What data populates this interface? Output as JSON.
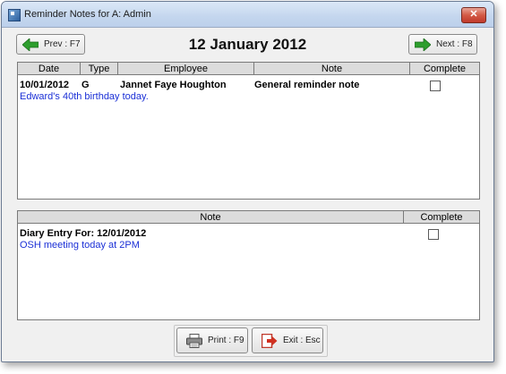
{
  "window": {
    "title": "Reminder Notes for A: Admin"
  },
  "nav": {
    "prev_label": "Prev : F7",
    "next_label": "Next : F8",
    "date_title": "12 January 2012"
  },
  "reminders": {
    "columns": [
      "Date",
      "Type",
      "Employee",
      "Note",
      "Complete"
    ],
    "rows": [
      {
        "date": "10/01/2012",
        "type": "G",
        "employee": "Jannet Faye Houghton",
        "note": "General reminder note",
        "complete": false,
        "detail": "Edward's 40th birthday today."
      }
    ]
  },
  "diary": {
    "columns": [
      "Note",
      "Complete"
    ],
    "rows": [
      {
        "heading": "Diary Entry For: 12/01/2012",
        "complete": false,
        "detail": "OSH meeting today at 2PM"
      }
    ]
  },
  "footer": {
    "print_label": "Print : F9",
    "exit_label": "Exit : Esc"
  },
  "icons": {
    "prev": "left-arrow-icon",
    "next": "right-arrow-icon",
    "print": "printer-icon",
    "exit": "exit-icon",
    "close": "close-icon",
    "app": "app-icon"
  },
  "colors": {
    "detail_text": "#1a2fd6",
    "arrow_green": "#2e9e2e",
    "close_red": "#c0392b"
  }
}
